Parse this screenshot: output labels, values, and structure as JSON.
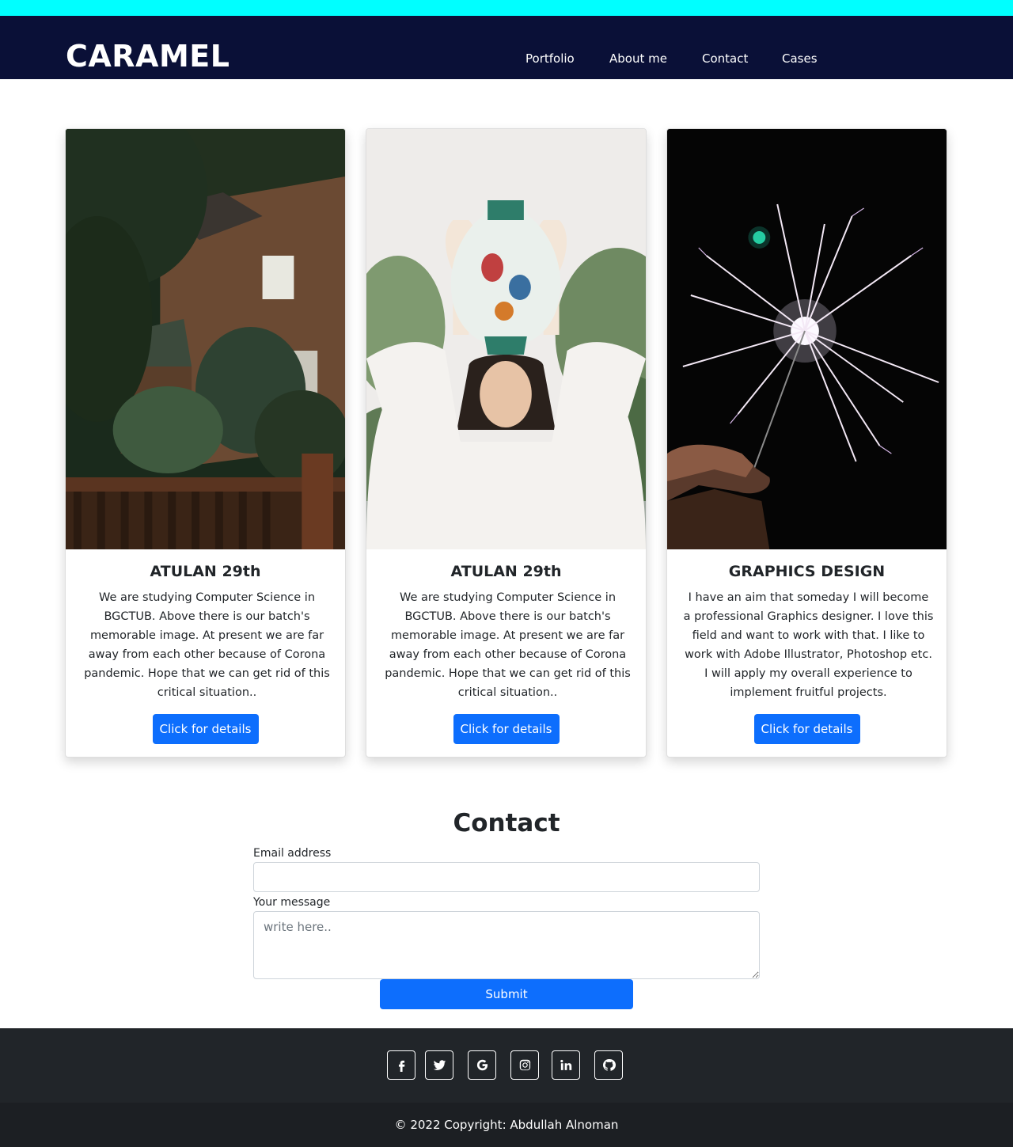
{
  "header": {
    "brand": "CARAMEL",
    "nav": [
      "Portfolio",
      "About me",
      "Contact",
      "Cases"
    ]
  },
  "cards": [
    {
      "image": "brick-house-garden-photo",
      "title": "ATULAN 29th",
      "text": "We are studying Computer Science in BGCTUB. Above there is our batch's memorable image. At present we are far away from each other because of Corona pandemic. Hope that we can get rid of this critical situation..",
      "button": "Click for details"
    },
    {
      "image": "woman-with-vase-photo",
      "title": "ATULAN 29th",
      "text": "We are studying Computer Science in BGCTUB. Above there is our batch's memorable image. At present we are far away from each other because of Corona pandemic. Hope that we can get rid of this critical situation..",
      "button": "Click for details"
    },
    {
      "image": "sparkler-in-hand-photo",
      "title": "GRAPHICS DESIGN",
      "text": "I have an aim that someday I will become a professional Graphics designer. I love this field and want to work with that. I like to work with Adobe Illustrator, Photoshop etc. I will apply my overall experience to implement fruitful projects.",
      "button": "Click for details"
    }
  ],
  "contact": {
    "heading": "Contact",
    "email_label": "Email address",
    "email_value": "",
    "message_label": "Your message",
    "message_placeholder": "write here..",
    "submit": "Submit"
  },
  "footer": {
    "social_icons": [
      "facebook-icon",
      "twitter-icon",
      "google-icon",
      "instagram-icon",
      "linkedin-icon",
      "github-icon"
    ],
    "copyright": "© 2022 Copyright: Abdullah Alnoman"
  },
  "colors": {
    "topbar": "#00ffff",
    "navbar": "#0a1037",
    "primary": "#0d6efd",
    "footer": "#212529",
    "footer_bottom": "#1c1f23"
  }
}
